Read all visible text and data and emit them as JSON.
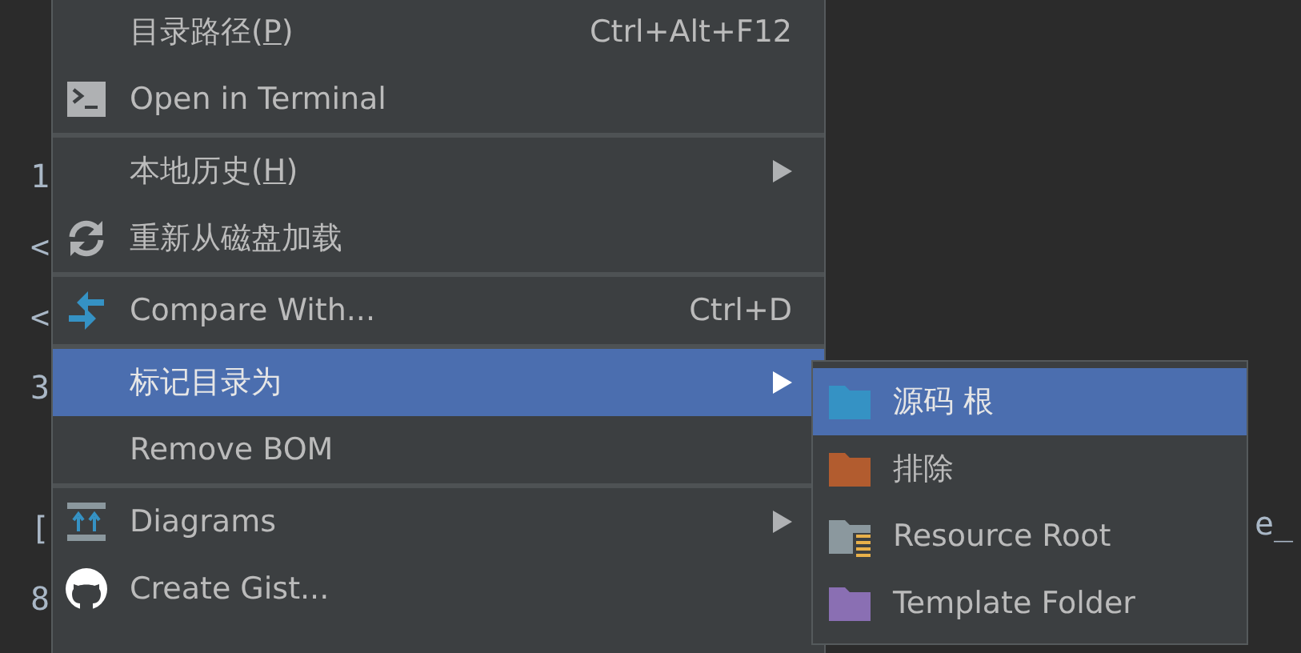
{
  "editor": {
    "lines": [
      "1",
      "<",
      "<",
      "3",
      "[",
      "8"
    ],
    "right_fragment": "e_"
  },
  "menu": {
    "groups": [
      {
        "items": [
          {
            "label": "目录路径(P)",
            "mnemonic": true,
            "shortcut": "Ctrl+Alt+F12",
            "selected": false
          },
          {
            "label": "Open in Terminal",
            "kind": "terminal",
            "selected": false
          }
        ]
      },
      {
        "items": [
          {
            "label": "本地历史(H)",
            "mnemonic": true,
            "submenu": true,
            "selected": false
          },
          {
            "label": "重新从磁盘加载",
            "kind": "reload",
            "selected": false
          }
        ]
      },
      {
        "items": [
          {
            "label": "Compare With...",
            "kind": "compare",
            "shortcut": "Ctrl+D",
            "selected": false
          }
        ]
      },
      {
        "items": [
          {
            "label": "标记目录为",
            "submenu": true,
            "selected": true
          },
          {
            "label": "Remove BOM",
            "selected": false
          }
        ]
      },
      {
        "items": [
          {
            "label": "Diagrams",
            "kind": "diagram",
            "submenu": true,
            "selected": false
          },
          {
            "label": "Create Gist...",
            "kind": "github",
            "selected": false
          }
        ]
      }
    ]
  },
  "submenu": {
    "items": [
      {
        "label": "源码 根",
        "kind": "folder",
        "color": "#3592c4",
        "selected": true
      },
      {
        "label": "排除",
        "kind": "folder",
        "color": "#b25c2f",
        "selected": false
      },
      {
        "label": "Resource Root",
        "kind": "resource",
        "color": "#8b989e",
        "selected": false
      },
      {
        "label": "Template Folder",
        "kind": "folder",
        "color": "#8a6fb3",
        "selected": false
      }
    ]
  }
}
